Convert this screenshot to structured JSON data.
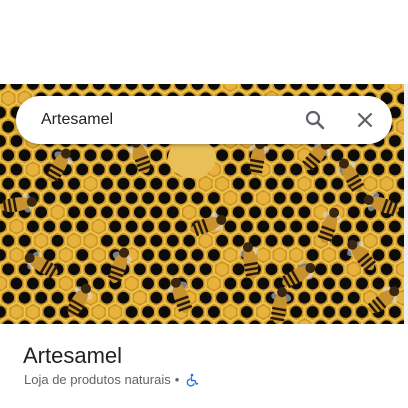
{
  "search": {
    "query": "Artesamel",
    "search_icon": "search-icon",
    "close_icon": "close-icon"
  },
  "photo": {
    "subject_icon": "photo"
  },
  "place": {
    "name": "Artesamel",
    "category": "Loja de produtos naturais",
    "separator": "•",
    "accessibility_icon": "wheelchair-accessible-icon",
    "accessibility_color": "#1a73e8"
  }
}
